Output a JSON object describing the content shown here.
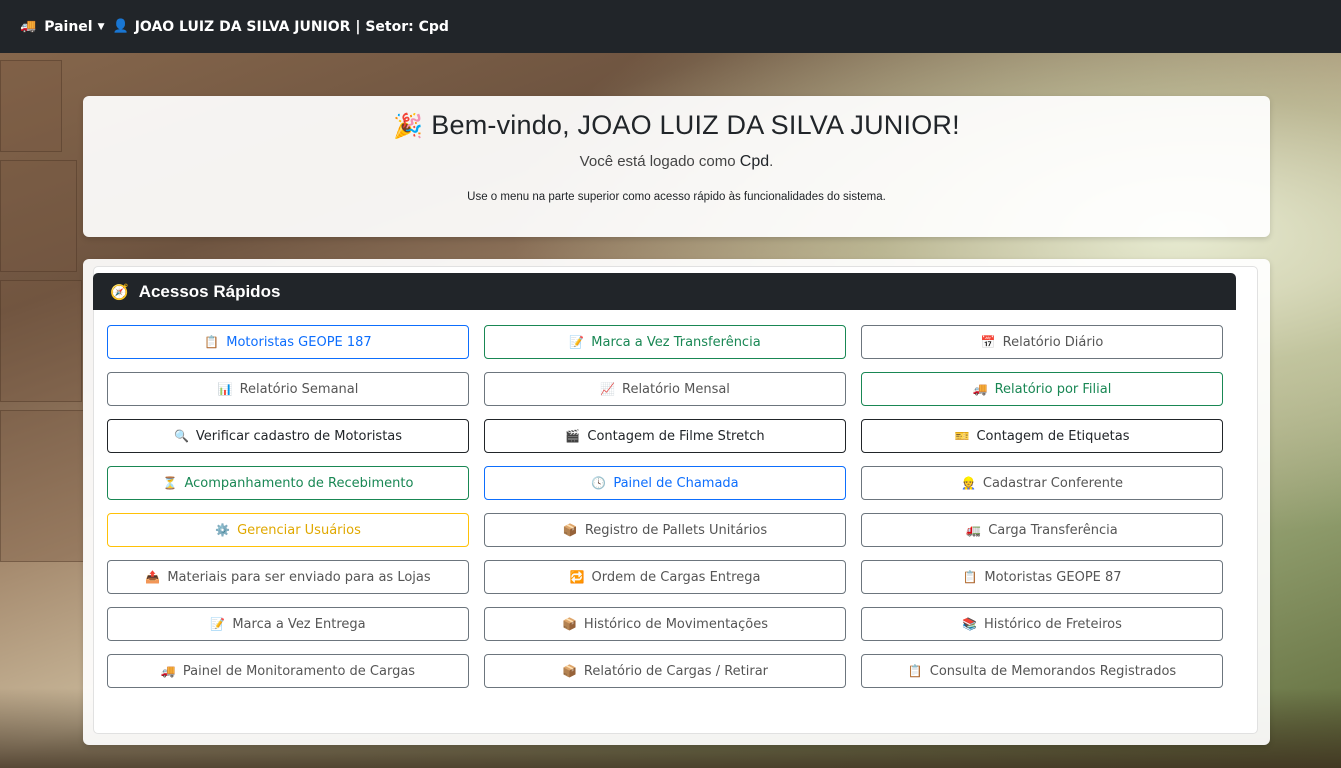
{
  "navbar": {
    "brand_icon": "🚚",
    "brand_label": "Painel",
    "caret": "▼",
    "user_icon": "👤",
    "user_label": "JOAO LUIZ DA SILVA JUNIOR | Setor: Cpd"
  },
  "welcome": {
    "icon": "🎉",
    "title": "Bem-vindo, JOAO LUIZ DA SILVA JUNIOR!",
    "logged_prefix": "Você está logado como",
    "role": "Cpd",
    "logged_suffix": ".",
    "hint": "Use o menu na parte superior como acesso rápido às funcionalidades do sistema."
  },
  "quick_access": {
    "icon": "🧭",
    "title": "Acessos Rápidos",
    "buttons": [
      {
        "label": "Motoristas GEOPE 187",
        "icon": "📋",
        "icon_name": "clipboard-icon",
        "style": "primary"
      },
      {
        "label": "Marca a Vez Transferência",
        "icon": "📝",
        "icon_name": "memo-icon",
        "style": "success"
      },
      {
        "label": "Relatório Diário",
        "icon": "📅",
        "icon_name": "calendar-icon",
        "style": "secondary"
      },
      {
        "label": "Relatório Semanal",
        "icon": "📊",
        "icon_name": "bar-chart-icon",
        "style": "secondary"
      },
      {
        "label": "Relatório Mensal",
        "icon": "📈",
        "icon_name": "line-chart-icon",
        "style": "secondary"
      },
      {
        "label": "Relatório por Filial",
        "icon": "🚚",
        "icon_name": "truck-icon",
        "style": "success"
      },
      {
        "label": "Verificar cadastro de Motoristas",
        "icon": "🔍",
        "icon_name": "magnifier-icon",
        "style": "dark"
      },
      {
        "label": "Contagem de Filme Stretch",
        "icon": "🎬",
        "icon_name": "clapper-icon",
        "style": "dark"
      },
      {
        "label": "Contagem de Etiquetas",
        "icon": "🎫",
        "icon_name": "ticket-icon",
        "style": "dark"
      },
      {
        "label": "Acompanhamento de Recebimento",
        "icon": "⏳",
        "icon_name": "hourglass-icon",
        "style": "success"
      },
      {
        "label": "Painel de Chamada",
        "icon": "🕓",
        "icon_name": "clock-icon",
        "style": "primary"
      },
      {
        "label": "Cadastrar Conferente",
        "icon": "👷",
        "icon_name": "worker-icon",
        "style": "secondary"
      },
      {
        "label": "Gerenciar Usuários",
        "icon": "⚙️",
        "icon_name": "gear-icon",
        "style": "warning"
      },
      {
        "label": "Registro de Pallets Unitários",
        "icon": "📦",
        "icon_name": "package-icon",
        "style": "secondary"
      },
      {
        "label": "Carga Transferência",
        "icon": "🚛",
        "icon_name": "lorry-icon",
        "style": "secondary"
      },
      {
        "label": "Materiais para ser enviado para as Lojas",
        "icon": "📤",
        "icon_name": "outbox-icon",
        "style": "secondary"
      },
      {
        "label": "Ordem de Cargas Entrega",
        "icon": "🔁",
        "icon_name": "repeat-icon",
        "style": "secondary"
      },
      {
        "label": "Motoristas GEOPE 87",
        "icon": "📋",
        "icon_name": "clipboard-icon",
        "style": "secondary"
      },
      {
        "label": "Marca a Vez Entrega",
        "icon": "📝",
        "icon_name": "memo-icon",
        "style": "secondary"
      },
      {
        "label": "Histórico de Movimentações",
        "icon": "📦",
        "icon_name": "package-icon",
        "style": "secondary"
      },
      {
        "label": "Histórico de Freteiros",
        "icon": "📚",
        "icon_name": "books-icon",
        "style": "secondary"
      },
      {
        "label": "Painel de Monitoramento de Cargas",
        "icon": "🚚",
        "icon_name": "truck-icon",
        "style": "secondary"
      },
      {
        "label": "Relatório de Cargas / Retirar",
        "icon": "📦",
        "icon_name": "package-icon",
        "style": "secondary"
      },
      {
        "label": "Consulta de Memorandos Registrados",
        "icon": "📋",
        "icon_name": "clipboard-icon",
        "style": "secondary"
      }
    ]
  }
}
